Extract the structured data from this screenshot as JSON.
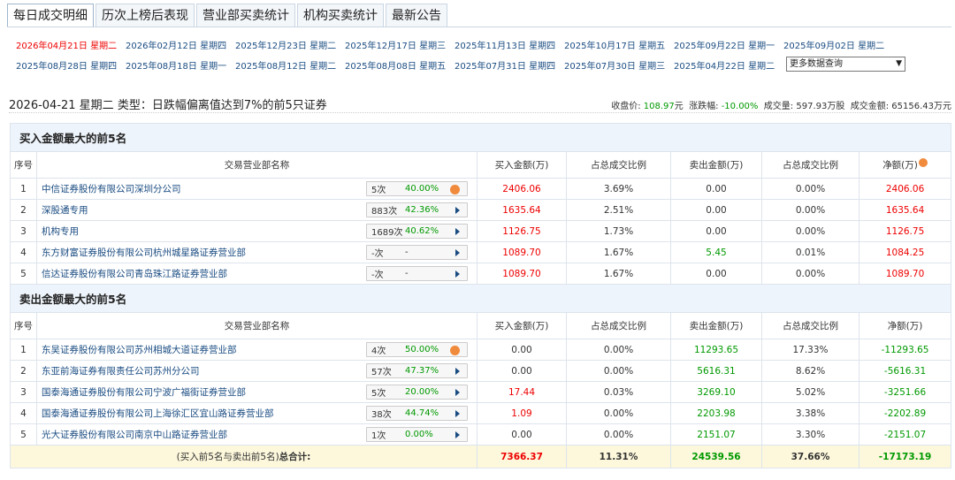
{
  "tabs": [
    "每日成交明细",
    "历次上榜后表现",
    "营业部买卖统计",
    "机构买卖统计",
    "最新公告"
  ],
  "dates_row1": [
    "2026年04月21日 星期二",
    "2026年02月12日 星期四",
    "2025年12月23日 星期二",
    "2025年12月17日 星期三",
    "2025年11月13日 星期四",
    "2025年10月17日 星期五",
    "2025年09月22日 星期一",
    "2025年09月02日 星期二"
  ],
  "dates_row2": [
    "2025年08月28日 星期四",
    "2025年08月18日 星期一",
    "2025年08月12日 星期二",
    "2025年08月08日 星期五",
    "2025年07月31日 星期四",
    "2025年07月30日 星期三",
    "2025年04月22日 星期二"
  ],
  "more_select": "更多数据查询",
  "summary": {
    "title": "2026-04-21 星期二 类型：日跌幅偏离值达到7%的前5只证券",
    "close_label": "收盘价:",
    "close_value": "108.97",
    "close_unit": "元",
    "change_label": "涨跌幅:",
    "change_value": "-10.00%",
    "volume_label": "成交量:",
    "volume_value": "597.93万股",
    "amount_label": "成交金额:",
    "amount_value": "65156.43万元"
  },
  "headers": [
    "序号",
    "交易营业部名称",
    "买入金额(万)",
    "占总成交比例",
    "卖出金额(万)",
    "占总成交比例",
    "净额(万)"
  ],
  "buy_section": {
    "title": "买入金额最大的前5名",
    "rows": [
      {
        "no": "1",
        "name": "中信证券股份有限公司深圳分公司",
        "cnt": "5次",
        "pct": "40.00%",
        "icon": "dot",
        "buy": "2406.06",
        "buy_pct": "3.69%",
        "sell": "0.00",
        "sell_pct": "0.00%",
        "net": "2406.06"
      },
      {
        "no": "2",
        "name": "深股通专用",
        "cnt": "883次",
        "pct": "42.36%",
        "icon": "tri",
        "buy": "1635.64",
        "buy_pct": "2.51%",
        "sell": "0.00",
        "sell_pct": "0.00%",
        "net": "1635.64"
      },
      {
        "no": "3",
        "name": "机构专用",
        "cnt": "1689次",
        "pct": "40.62%",
        "icon": "tri",
        "buy": "1126.75",
        "buy_pct": "1.73%",
        "sell": "0.00",
        "sell_pct": "0.00%",
        "net": "1126.75"
      },
      {
        "no": "4",
        "name": "东方财富证券股份有限公司杭州城星路证券营业部",
        "cnt": "-次",
        "pct": "-",
        "icon": "tri",
        "buy": "1089.70",
        "buy_pct": "1.67%",
        "sell": "5.45",
        "sell_pct": "0.01%",
        "net": "1084.25"
      },
      {
        "no": "5",
        "name": "信达证券股份有限公司青岛珠江路证券营业部",
        "cnt": "-次",
        "pct": "-",
        "icon": "tri",
        "buy": "1089.70",
        "buy_pct": "1.67%",
        "sell": "0.00",
        "sell_pct": "0.00%",
        "net": "1089.70"
      }
    ]
  },
  "sell_section": {
    "title": "卖出金额最大的前5名",
    "rows": [
      {
        "no": "1",
        "name": "东吴证券股份有限公司苏州相城大道证券营业部",
        "cnt": "4次",
        "pct": "50.00%",
        "icon": "dot",
        "buy": "0.00",
        "buy_pct": "0.00%",
        "sell": "11293.65",
        "sell_pct": "17.33%",
        "net": "-11293.65"
      },
      {
        "no": "2",
        "name": "东亚前海证券有限责任公司苏州分公司",
        "cnt": "57次",
        "pct": "47.37%",
        "icon": "tri",
        "buy": "0.00",
        "buy_pct": "0.00%",
        "sell": "5616.31",
        "sell_pct": "8.62%",
        "net": "-5616.31"
      },
      {
        "no": "3",
        "name": "国泰海通证券股份有限公司宁波广福街证券营业部",
        "cnt": "5次",
        "pct": "20.00%",
        "icon": "tri",
        "buy": "17.44",
        "buy_pct": "0.03%",
        "sell": "3269.10",
        "sell_pct": "5.02%",
        "net": "-3251.66"
      },
      {
        "no": "4",
        "name": "国泰海通证券股份有限公司上海徐汇区宜山路证券营业部",
        "cnt": "38次",
        "pct": "44.74%",
        "icon": "tri",
        "buy": "1.09",
        "buy_pct": "0.00%",
        "sell": "2203.98",
        "sell_pct": "3.38%",
        "net": "-2202.89"
      },
      {
        "no": "5",
        "name": "光大证券股份有限公司南京中山路证券营业部",
        "cnt": "1次",
        "pct": "0.00%",
        "icon": "tri",
        "buy": "0.00",
        "buy_pct": "0.00%",
        "sell": "2151.07",
        "sell_pct": "3.30%",
        "net": "-2151.07"
      }
    ]
  },
  "total": {
    "label_prefix": "(买入前5名与卖出前5名)",
    "label_bold": "总合计:",
    "buy": "7366.37",
    "buy_pct": "11.31%",
    "sell": "24539.56",
    "sell_pct": "37.66%",
    "net": "-17173.19"
  }
}
